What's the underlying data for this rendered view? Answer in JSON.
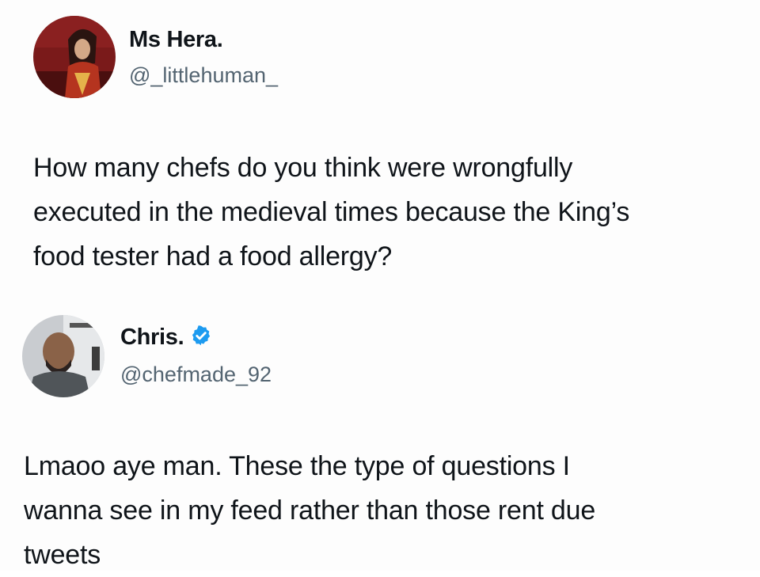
{
  "tweets": [
    {
      "author": {
        "display_name": "Ms Hera.",
        "handle": "@_littlehuman_",
        "avatar_icon": "profile-photo-icon"
      },
      "text_lines": [
        "How many chefs do you think were wrongfully",
        "executed in the medieval times because the King’s",
        "food tester had a food allergy?"
      ]
    },
    {
      "author": {
        "display_name": "Chris.",
        "handle": "@chefmade_92",
        "verified": true,
        "verified_icon": "verified-badge-icon",
        "verified_color": "#1d9bf0",
        "avatar_icon": "profile-photo-icon"
      },
      "text_lines": [
        "Lmaoo aye man. These the type of questions I",
        "wanna see in my feed rather than those rent due",
        "tweets"
      ]
    }
  ]
}
